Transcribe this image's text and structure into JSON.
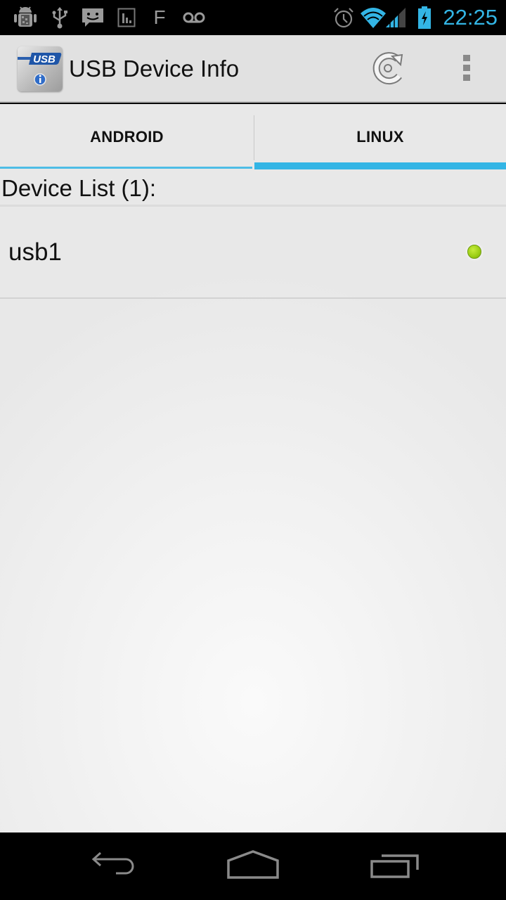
{
  "status_bar": {
    "time": "22:25",
    "accent_color": "#33b5e5",
    "left_icons": [
      "android-debug-icon",
      "usb-icon",
      "chat-message-icon",
      "stats-icon",
      "f-letter-icon",
      "voicemail-icon"
    ],
    "right_icons": [
      "alarm-icon",
      "wifi-icon",
      "cell-signal-icon",
      "battery-charging-icon"
    ],
    "f_glyph": "F"
  },
  "action_bar": {
    "app_title": "USB Device Info",
    "app_icon": "usb-info-app-icon",
    "app_icon_text": "USB",
    "actions": [
      {
        "name": "refresh",
        "icon": "refresh-icon"
      },
      {
        "name": "overflow-menu",
        "icon": "overflow-menu-icon"
      }
    ]
  },
  "tabs": {
    "items": [
      {
        "label": "ANDROID",
        "selected": false
      },
      {
        "label": "LINUX",
        "selected": true
      }
    ],
    "indicator_color": "#33b5e5"
  },
  "device_list": {
    "header": "Device List (1):",
    "count": 1,
    "items": [
      {
        "label": "usb1",
        "status": "connected",
        "status_color": "#9acd13"
      }
    ]
  },
  "nav_bar": {
    "buttons": [
      {
        "name": "back",
        "icon": "back-icon"
      },
      {
        "name": "home",
        "icon": "home-icon"
      },
      {
        "name": "recent-apps",
        "icon": "recent-apps-icon"
      }
    ]
  }
}
